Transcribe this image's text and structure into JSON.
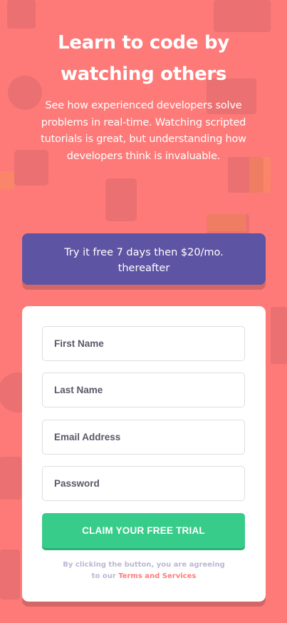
{
  "hero": {
    "title_line1": "Learn to code by",
    "title_line2": "watching others",
    "desc_line1": "See how experienced developers solve",
    "desc_line2": "problems in real-time. Watching scripted",
    "desc_line3": "tutorials is great, but understanding how",
    "desc_line4": "developers think is invaluable."
  },
  "promo": {
    "line1": "Try it free 7 days then $20/mo.",
    "line2": "thereafter"
  },
  "form": {
    "first_name": {
      "placeholder": "First Name",
      "value": ""
    },
    "last_name": {
      "placeholder": "Last Name",
      "value": ""
    },
    "email": {
      "placeholder": "Email Address",
      "value": ""
    },
    "password": {
      "placeholder": "Password",
      "value": ""
    },
    "submit_label": "CLAIM YOUR FREE TRIAL",
    "terms_prefix": "By clicking the button, you are agreeing",
    "terms_to": "to our",
    "terms_link": "Terms and Services"
  },
  "colors": {
    "background": "#fd7a79",
    "promo": "#5e54a4",
    "button": "#38cc8b",
    "link": "#ff7a7a"
  }
}
